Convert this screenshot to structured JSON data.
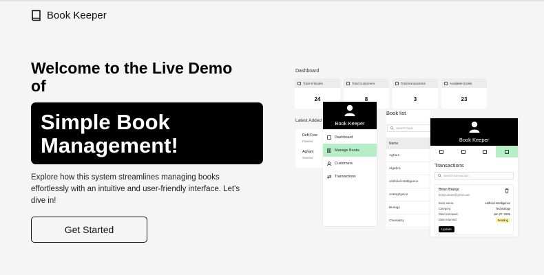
{
  "header": {
    "brand_name": "Book Keeper",
    "brand_icon": "book-icon"
  },
  "hero": {
    "title": "Welcome to the Live Demo of",
    "highlight": "Simple Book Management!",
    "description": "Explore how this system streamlines managing books effortlessly with an intuitive and user-friendly interface. Let's dive in!",
    "cta_label": "Get Started"
  },
  "mockup": {
    "dashboard": {
      "title": "Dashboard",
      "stats": [
        {
          "label": "Total of Books",
          "value": "24"
        },
        {
          "label": "Total Customers",
          "value": "8"
        },
        {
          "label": "Total transactions",
          "value": "3"
        },
        {
          "label": "Available books",
          "value": "23"
        }
      ],
      "latest_title": "Latest Added B",
      "latest_books": [
        {
          "title": "Deft-Free",
          "category": "Finance"
        },
        {
          "title": "Agham",
          "category": "Science"
        }
      ]
    },
    "nav": {
      "brand": "Book Keeper",
      "items": [
        {
          "label": "Dashboard",
          "icon": "dashboard-icon"
        },
        {
          "label": "Manage Books",
          "icon": "books-icon"
        },
        {
          "label": "Customers",
          "icon": "users-icon"
        },
        {
          "label": "Transactions",
          "icon": "transactions-icon"
        }
      ]
    },
    "book_list": {
      "title": "Book list",
      "search_placeholder": "Search book",
      "column": "Name",
      "rows": [
        "Agham",
        "Algebra",
        "Artificial Intelligence",
        "Astrophysics",
        "Biology",
        "Chemistry"
      ]
    },
    "transactions": {
      "brand": "Book Keeper",
      "title": "Transactions",
      "search_placeholder": "Search transaction",
      "card": {
        "name": "Brian Branja",
        "email": "branja.brian@gmail.com",
        "fields": [
          {
            "key": "Book name:",
            "value": "Artificial Intelligence"
          },
          {
            "key": "Category:",
            "value": "Technology"
          },
          {
            "key": "Date borrowed:",
            "value": "Jan 27, 2025"
          },
          {
            "key": "Date returned:",
            "value": "Pending"
          }
        ],
        "update_label": "Update"
      }
    }
  },
  "colors": {
    "accent": "#b6efc7",
    "dark": "#000000",
    "background": "#f5f5f5",
    "pending": "#fff3a8"
  }
}
